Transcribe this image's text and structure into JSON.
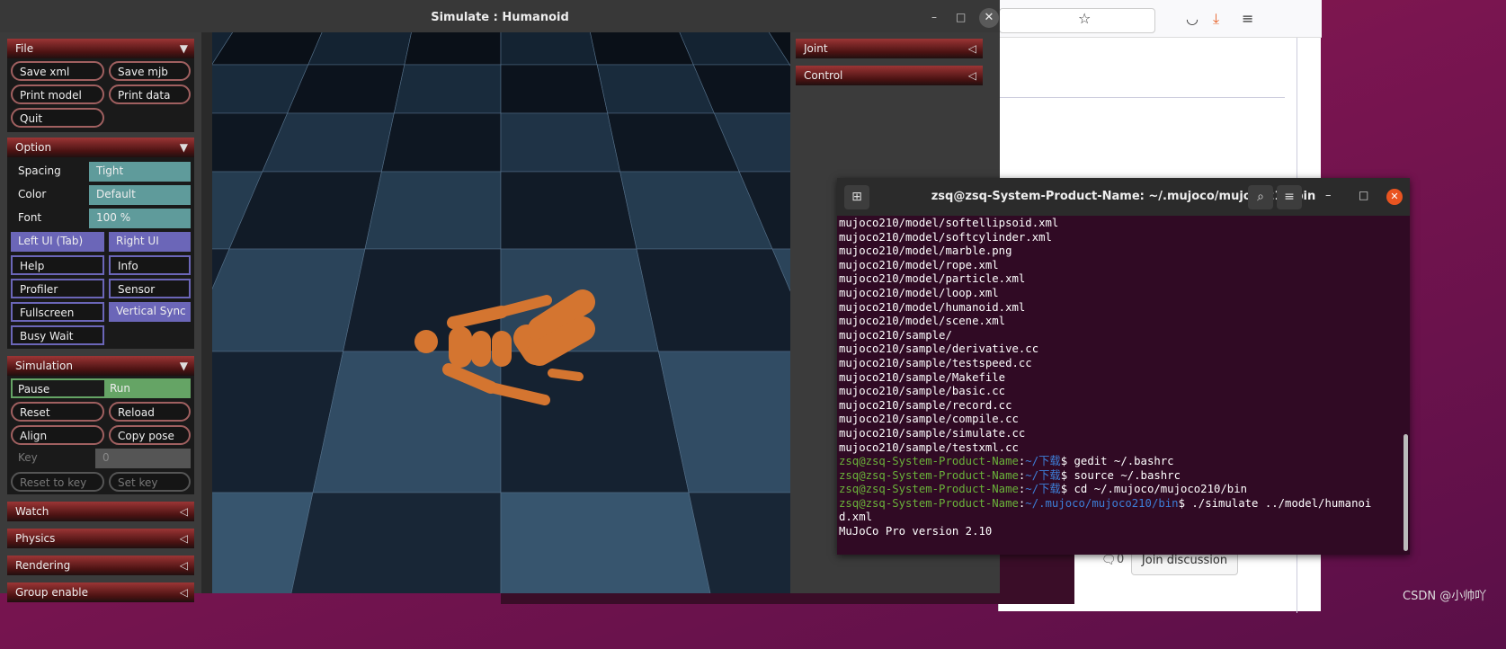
{
  "simulate": {
    "title": "Simulate : Humanoid",
    "file": {
      "header": "File",
      "buttons": [
        "Save xml",
        "Save mjb",
        "Print model",
        "Print data",
        "Quit"
      ]
    },
    "option": {
      "header": "Option",
      "spacing_label": "Spacing",
      "spacing_value": "Tight",
      "color_label": "Color",
      "color_value": "Default",
      "font_label": "Font",
      "font_value": "100 %",
      "toggles": [
        {
          "label": "Left UI (Tab)",
          "on": true
        },
        {
          "label": "Right UI",
          "on": true
        },
        {
          "label": "Help",
          "on": false
        },
        {
          "label": "Info",
          "on": false
        },
        {
          "label": "Profiler",
          "on": false
        },
        {
          "label": "Sensor",
          "on": false
        },
        {
          "label": "Fullscreen",
          "on": false
        },
        {
          "label": "Vertical Sync",
          "on": true
        },
        {
          "label": "Busy Wait",
          "on": false
        }
      ]
    },
    "simulation": {
      "header": "Simulation",
      "pause": "Pause",
      "run": "Run",
      "selected": "Run",
      "buttons": [
        "Reset",
        "Reload",
        "Align",
        "Copy pose"
      ],
      "key_label": "Key",
      "key_value": "0",
      "reset_to_key": "Reset to key",
      "set_key": "Set key"
    },
    "collapsed": [
      "Watch",
      "Physics",
      "Rendering",
      "Group enable"
    ],
    "right": [
      "Joint",
      "Control"
    ]
  },
  "terminal": {
    "title": "zsq@zsq-System-Product-Name: ~/.mujoco/mujoco210/bin",
    "output": [
      "mujoco210/model/softellipsoid.xml",
      "mujoco210/model/softcylinder.xml",
      "mujoco210/model/marble.png",
      "mujoco210/model/rope.xml",
      "mujoco210/model/particle.xml",
      "mujoco210/model/loop.xml",
      "mujoco210/model/humanoid.xml",
      "mujoco210/model/scene.xml",
      "mujoco210/sample/",
      "mujoco210/sample/derivative.cc",
      "mujoco210/sample/testspeed.cc",
      "mujoco210/sample/Makefile",
      "mujoco210/sample/basic.cc",
      "mujoco210/sample/record.cc",
      "mujoco210/sample/compile.cc",
      "mujoco210/sample/simulate.cc",
      "mujoco210/sample/testxml.cc"
    ],
    "prompts": [
      {
        "user": "zsq@zsq-System-Product-Name",
        "path": "~/下载",
        "cmd": "gedit ~/.bashrc"
      },
      {
        "user": "zsq@zsq-System-Product-Name",
        "path": "~/下载",
        "cmd": "source ~/.bashrc"
      },
      {
        "user": "zsq@zsq-System-Product-Name",
        "path": "~/下载",
        "cmd": "cd ~/.mujoco/mujoco210/bin"
      },
      {
        "user": "zsq@zsq-System-Product-Name",
        "path": "~/.mujoco/mujoco210/bin",
        "cmd": "./simulate ../model/humanoi"
      }
    ],
    "tail": [
      "d.xml",
      "MuJoCo Pro version 2.10"
    ]
  },
  "browser": {
    "comment_count": "0",
    "join_label": "Join discussion"
  },
  "watermark": "CSDN @小帅吖",
  "colors": {
    "accent_red": "#9c3535",
    "teal": "#5f9b9b",
    "purple": "#6b66b8",
    "green": "#65a465",
    "terminal_bg": "#300a24"
  }
}
